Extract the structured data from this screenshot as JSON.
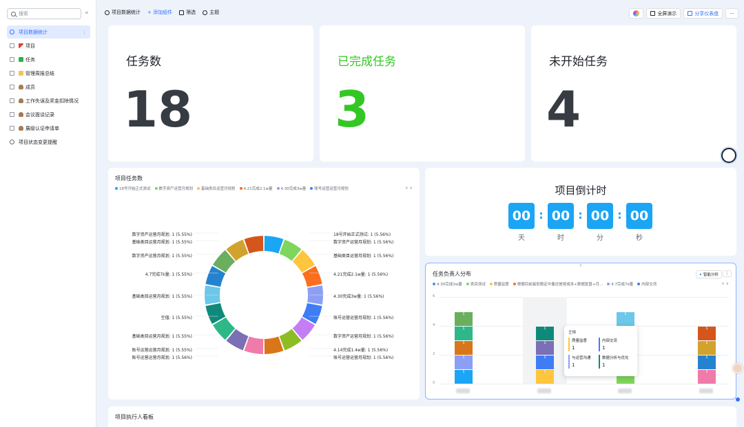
{
  "sidebar": {
    "search_placeholder": "搜索",
    "collapse_icon": "«",
    "items": [
      {
        "label": "项目数据统计",
        "icon": "dashboard-icon",
        "active": true
      },
      {
        "label": "项目",
        "icon": "flag-icon"
      },
      {
        "label": "任务",
        "icon": "check-icon"
      },
      {
        "label": "管理周报总结",
        "icon": "memo-icon"
      },
      {
        "label": "成员",
        "icon": "person-icon"
      },
      {
        "label": "工作失误及奖金扣除情况",
        "icon": "person-icon"
      },
      {
        "label": "会议面谈记录",
        "icon": "person-icon"
      },
      {
        "label": "展级认证申请单",
        "icon": "person-icon"
      },
      {
        "label": "项目状态变更提醒",
        "icon": "workflow-icon"
      }
    ]
  },
  "topbar": {
    "title": "项目数据统计",
    "add_widget": "+ 添加组件",
    "filter": "筛选",
    "theme": "主题",
    "fullscreen": "全屏演示",
    "share": "分享仪表盘",
    "more": "···"
  },
  "stats": {
    "total_label": "任务数",
    "total_value": "18",
    "done_label": "已完成任务",
    "done_value": "3",
    "todo_label": "未开始任务",
    "todo_value": "4"
  },
  "donut": {
    "title": "项目任务数",
    "legend": [
      {
        "name": "18号开始正式测试",
        "color": "#1aa5f5"
      },
      {
        "name": "数字资产运营月规划",
        "color": "#7fd65c"
      },
      {
        "name": "基础类目运营月规划",
        "color": "#ffc53d"
      },
      {
        "name": "4.21完成2.1w量",
        "color": "#fa6e1e"
      },
      {
        "name": "4.30完成3w量",
        "color": "#8c9ef5"
      },
      {
        "name": "账号运营运营月规划",
        "color": "#3f7df6"
      }
    ],
    "left_labels": [
      "数字资产运营月规划: 1 (5.55%)",
      "基础类目运营月规划: 1 (5.55%)",
      "数字资产运营月规划: 1 (5.55%)",
      "4.7完成7k量: 1 (5.55%)",
      "基础类目运营月规划: 1 (5.55%)",
      "空值: 1 (5.55%)",
      "基础类目运营月规划: 1 (5.55%)",
      "账号运营运营月规划: 1 (5.55%)",
      "账号运营运营月规划: 1 (5.56%)"
    ],
    "right_labels": [
      "18号开始正式测试: 1 (5.56%)",
      "数字资产运营月规划: 1 (5.56%)",
      "基础类目运营月规划: 1 (5.56%)",
      "4.21完成2.1w量: 1 (5.56%)",
      "4.30完成3w量: 1 (5.56%)",
      "账号运营运营月规划: 1 (5.56%)",
      "数字资产运营月规划: 1 (5.56%)",
      "4.14完成1.4w量: 1 (5.56%)",
      "账号运营运营月规划: 1 (5.56%)"
    ],
    "slice_colors": [
      "#1aa5f5",
      "#7fd65c",
      "#ffc53d",
      "#fa6e1e",
      "#8c9ef5",
      "#3f7df6",
      "#c57df6",
      "#8cbd24",
      "#d9761a",
      "#f07aa9",
      "#7b6fb5",
      "#2eb88a",
      "#0f8a7a",
      "#6cc7e8",
      "#2483cf",
      "#6aaf5e",
      "#d1a22e",
      "#d4561c"
    ]
  },
  "countdown": {
    "title": "项目倒计时",
    "units": [
      {
        "value": "00",
        "label": "天"
      },
      {
        "value": "00",
        "label": "时"
      },
      {
        "value": "00",
        "label": "分"
      },
      {
        "value": "00",
        "label": "秒"
      }
    ],
    "separator": ":"
  },
  "bar_chart": {
    "title": "任务负责人分布",
    "smart_analysis": "智能分析",
    "legend": [
      {
        "name": "4.30完成3w量",
        "color": "#3f95f5"
      },
      {
        "name": "类目测试",
        "color": "#7fd65c"
      },
      {
        "name": "质量监督",
        "color": "#ffc53d"
      },
      {
        "name": "根据目前最低稳定中量还是按成本+数据复盘+月...",
        "color": "#fa6e1e"
      },
      {
        "name": "4.7完成7k量",
        "color": "#8c9ef5"
      },
      {
        "name": "内部交流",
        "color": "#3f7df6"
      }
    ],
    "y_ticks": [
      "6",
      "4",
      "2",
      "0"
    ],
    "segment_label": "1",
    "tooltip": {
      "name": "王恒",
      "items": [
        {
          "label": "质量监督",
          "value": "1",
          "color": "#ffc53d"
        },
        {
          "label": "内部交流",
          "value": "1",
          "color": "#3f7df6"
        },
        {
          "label": "与运营沟通",
          "value": "1",
          "color": "#8c9ef5"
        },
        {
          "label": "数据分析与优化",
          "value": "1",
          "color": "#0f8a7a"
        }
      ]
    }
  },
  "board": {
    "title": "项目执行人看板"
  },
  "chart_data": [
    {
      "type": "pie",
      "title": "项目任务数",
      "total": 18,
      "slice_count": 18,
      "values": [
        1,
        1,
        1,
        1,
        1,
        1,
        1,
        1,
        1,
        1,
        1,
        1,
        1,
        1,
        1,
        1,
        1,
        1
      ]
    },
    {
      "type": "bar",
      "title": "任务负责人分布",
      "ylim": [
        0,
        6
      ],
      "stacked": true,
      "stack_totals": [
        5,
        4,
        5,
        4
      ]
    }
  ]
}
